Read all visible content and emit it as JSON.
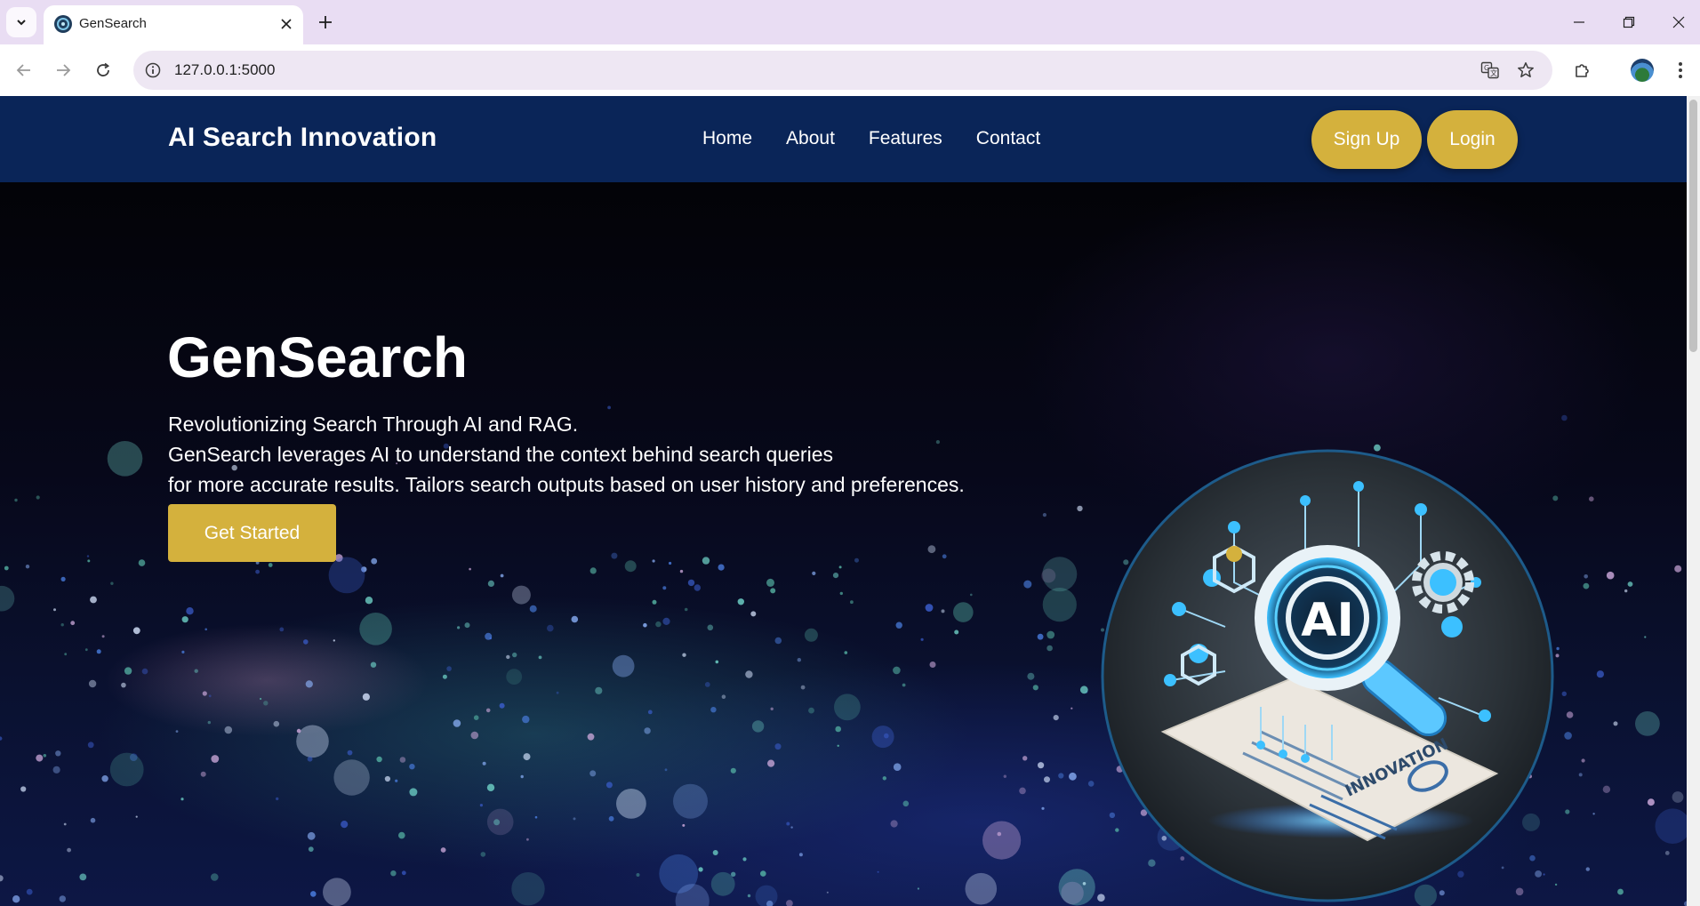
{
  "browser": {
    "tab_title": "GenSearch",
    "url": "127.0.0.1:5000"
  },
  "nav": {
    "brand": "AI Search Innovation",
    "links": [
      "Home",
      "About",
      "Features",
      "Contact"
    ],
    "signup": "Sign Up",
    "login": "Login"
  },
  "hero": {
    "title": "GenSearch",
    "subtitle_lines": [
      "Revolutionizing Search Through AI and RAG.",
      "GenSearch leverages AI to understand the context behind search queries",
      "for more accurate results. Tailors search outputs based on user history and preferences."
    ],
    "cta": "Get Started",
    "logo_center_text": "AI",
    "logo_doc_text": "INNOVATION"
  },
  "colors": {
    "navbar": "#0a2558",
    "accent_gold": "#d4b13d",
    "chrome_tabbar": "#e9ddf3"
  },
  "icons": {
    "favicon": "globe-icon",
    "site_info": "info-icon",
    "translate": "translate-icon",
    "bookmark": "star-icon",
    "extensions": "puzzle-icon",
    "menu": "more-vert-icon"
  }
}
